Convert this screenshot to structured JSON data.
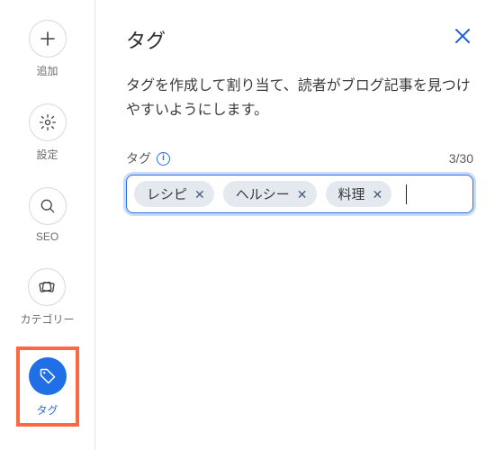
{
  "sidebar": {
    "items": [
      {
        "id": "add",
        "label": "追加"
      },
      {
        "id": "settings",
        "label": "設定"
      },
      {
        "id": "seo",
        "label": "SEO"
      },
      {
        "id": "category",
        "label": "カテゴリー"
      },
      {
        "id": "tag",
        "label": "タグ"
      }
    ]
  },
  "panel": {
    "title": "タグ",
    "description": "タグを作成して割り当て、読者がブログ記事を見つけやすいようにします。",
    "field_label": "タグ",
    "counter": "3/30",
    "tags": [
      "レシピ",
      "ヘルシー",
      "料理"
    ]
  }
}
